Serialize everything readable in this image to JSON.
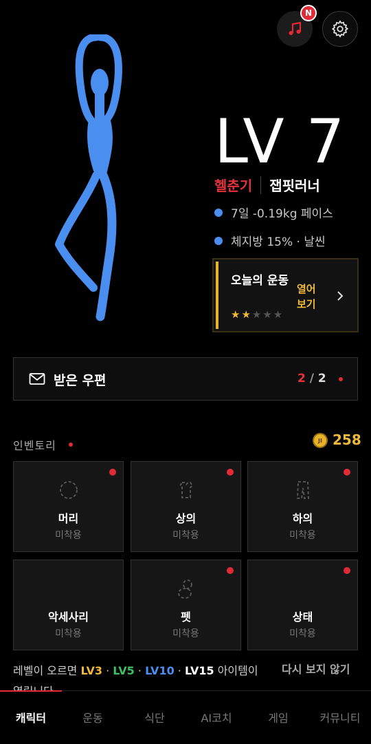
{
  "top": {
    "notification_badge": "N",
    "music_icon": "music-note-icon",
    "settings_icon": "gear-icon"
  },
  "level": {
    "text": "LV 7"
  },
  "titles": {
    "primary": "헬춘기",
    "secondary": "잽핏러너"
  },
  "stats": [
    {
      "text": "7일 -0.19kg 페이스"
    },
    {
      "text": "체지방 15% · 날씬"
    }
  ],
  "workout": {
    "title": "오늘의 운동",
    "rating": 2,
    "rating_max": 5,
    "stars_on": "★★",
    "stars_off": "★★★",
    "open_label": "열어 보기"
  },
  "mail": {
    "label": "받은 우편",
    "unread": "2",
    "sep": "/",
    "total": "2"
  },
  "inventory": {
    "title": "인벤토리",
    "coin_symbol": "JI",
    "coins": "258",
    "slots": [
      {
        "name": "머리",
        "state": "미착용",
        "new": true,
        "icon": "head-outline-icon"
      },
      {
        "name": "상의",
        "state": "미착용",
        "new": true,
        "icon": "shirt-outline-icon"
      },
      {
        "name": "하의",
        "state": "미착용",
        "new": true,
        "icon": "pants-outline-icon"
      },
      {
        "name": "악세사리",
        "state": "미착용",
        "new": false,
        "icon": ""
      },
      {
        "name": "펫",
        "state": "미착용",
        "new": true,
        "icon": "pet-outline-icon"
      },
      {
        "name": "상태",
        "state": "미착용",
        "new": true,
        "icon": ""
      }
    ]
  },
  "notice": {
    "prefix": "레벨이 오르면 ",
    "lv3": "LV3",
    "lv5": "LV5",
    "lv10": "LV10",
    "lv15": "LV15",
    "sep": " · ",
    "suffix": " 아이템이 열립니다",
    "dismiss": "다시 보지 않기"
  },
  "nav": {
    "tabs": [
      {
        "label": "캐릭터",
        "active": true
      },
      {
        "label": "운동",
        "active": false
      },
      {
        "label": "식단",
        "active": false
      },
      {
        "label": "AI코치",
        "active": false
      },
      {
        "label": "게임",
        "active": false
      },
      {
        "label": "커뮤니티",
        "active": false
      }
    ]
  },
  "colors": {
    "accent_red": "#e22a36",
    "accent_gold": "#f0b93a",
    "figure_blue": "#4a8ef0",
    "green": "#3fbf62"
  }
}
